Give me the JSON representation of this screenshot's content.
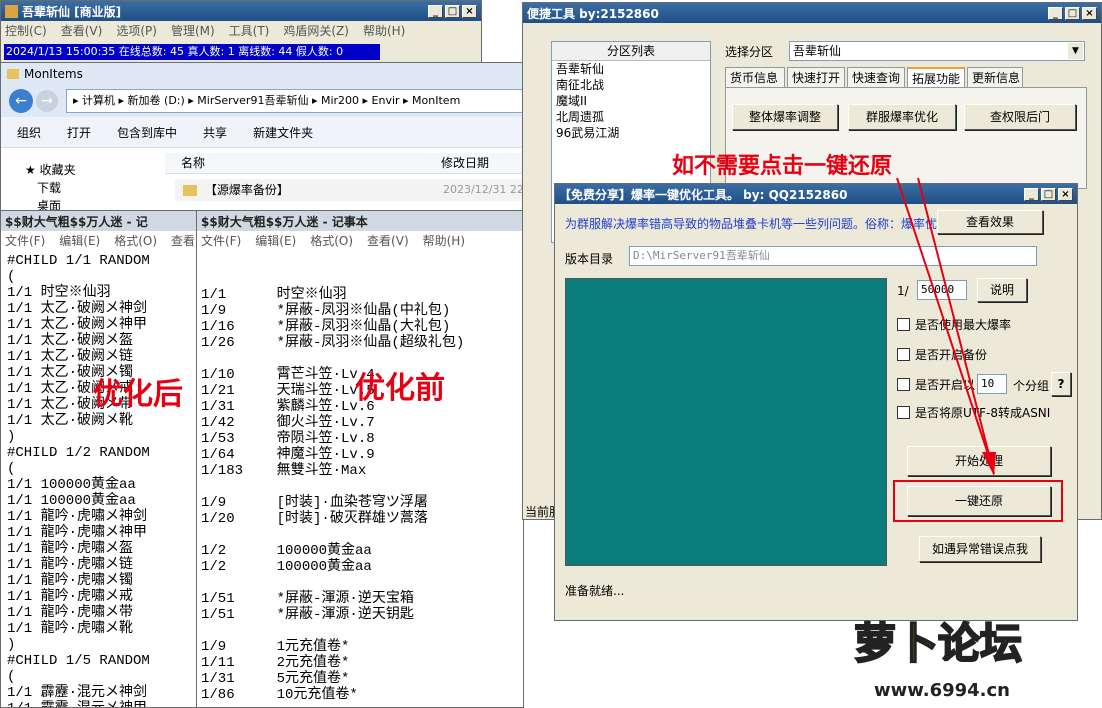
{
  "main_window": {
    "title": "吾辈斩仙 [商业版]",
    "menu": [
      "控制(C)",
      "查看(V)",
      "选项(P)",
      "管理(M)",
      "工具(T)",
      "鸡盾网关(Z)",
      "帮助(H)"
    ],
    "status": "2024/1/13 15:00:35 在线总数: 45 真人数: 1 离线数: 44 假人数: 0"
  },
  "explorer": {
    "title": "MonItems",
    "path": "▸ 计算机 ▸ 新加卷 (D:) ▸ MirServer91吾辈斩仙 ▸ Mir200 ▸ Envir ▸ MonItem",
    "toolbar": [
      "组织",
      "打开",
      "包含到库中",
      "共享",
      "新建文件夹"
    ],
    "nav": [
      "收藏夹",
      "下载",
      "桌面"
    ],
    "columns": [
      "名称",
      "修改日期"
    ],
    "files": [
      {
        "name": "【源爆率备份】",
        "date": "2023/12/31 22"
      }
    ]
  },
  "notepad_left": {
    "title": "$$财大气粗$$万人迷 - 记",
    "menu": [
      "文件(F)",
      "编辑(E)",
      "格式(O)",
      "查看"
    ],
    "lines": [
      "#CHILD 1/1 RANDOM",
      "(",
      "1/1 时空※仙羽",
      "1/1 太乙·破阙メ神剑",
      "1/1 太乙·破阙メ神甲",
      "1/1 太乙·破阙メ盔",
      "1/1 太乙·破阙メ链",
      "1/1 太乙·破阙メ镯",
      "1/1 太乙·破阙メ戒",
      "1/1 太乙·破阙メ带",
      "1/1 太乙·破阙メ靴",
      ")",
      "#CHILD 1/2 RANDOM",
      "(",
      "1/1 100000黄金aa",
      "1/1 100000黄金aa",
      "1/1 龍吟·虎嘯メ神剑",
      "1/1 龍吟·虎嘯メ神甲",
      "1/1 龍吟·虎嘯メ盔",
      "1/1 龍吟·虎嘯メ链",
      "1/1 龍吟·虎嘯メ镯",
      "1/1 龍吟·虎嘯メ戒",
      "1/1 龍吟·虎嘯メ带",
      "1/1 龍吟·虎嘯メ靴",
      ")",
      "#CHILD 1/5 RANDOM",
      "(",
      "1/1 霹靂·混元メ神剑",
      "1/1 霹靂·混元メ神甲"
    ],
    "overlay": "优化后"
  },
  "notepad_right": {
    "title": "$$财大气粗$$万人迷 - 记事本",
    "menu": [
      "文件(F)",
      "编辑(E)",
      "格式(O)",
      "查看(V)",
      "帮助(H)"
    ],
    "lines": [
      "",
      "1/1      时空※仙羽",
      "1/9      *屏蔽-凤羽※仙晶(中礼包)",
      "1/16     *屏蔽-凤羽※仙晶(大礼包)",
      "1/26     *屏蔽-凤羽※仙晶(超级礼包)",
      "",
      "1/10     霄芒斗笠·Lv.4",
      "1/21     天瑞斗笠·Lv.5",
      "1/31     紫麟斗笠·Lv.6",
      "1/42     御火斗笠·Lv.7",
      "1/53     帝陨斗笠·Lv.8",
      "1/64     神魔斗笠·Lv.9",
      "1/183    無雙斗笠·Max",
      "",
      "1/9      [时装]·血染苍穹ツ浮屠",
      "1/20     [时装]·破灭群雄ツ蒿落",
      "",
      "1/2      100000黄金aa",
      "1/2      100000黄金aa",
      "",
      "1/51     *屏蔽-渾源·逆天宝箱",
      "1/51     *屏蔽-渾源·逆天钥匙",
      "",
      "1/9      1元充值卷*",
      "1/11     2元充值卷*",
      "1/31     5元充值卷*",
      "1/86     10元充值卷*"
    ],
    "overlay": "优化前"
  },
  "quick_tool": {
    "title": "便捷工具  by:2152860",
    "partition_header": "分区列表",
    "partitions": [
      "吾辈斩仙",
      "南征北战",
      "魔域II",
      "北周遗孤",
      "96武易江湖"
    ],
    "select_label": "选择分区",
    "select_value": "吾辈斩仙",
    "tabs": [
      "货币信息",
      "快速打开",
      "快速查询",
      "拓展功能",
      "更新信息"
    ],
    "buttons": [
      "整体爆率调整",
      "群服爆率优化",
      "查权限后门"
    ],
    "statusbar": "当前服"
  },
  "annotation": "如不需要点击一键还原",
  "optimizer": {
    "title": "【免费分享】爆率一键优化工具。   by: QQ2152860",
    "desc": "为群服解决爆率错高导致的物品堆叠卡机等一些列问题。俗称：爆率优化",
    "view_effect": "查看效果",
    "version_label": "版本目录",
    "version_path": "D:\\MirServer91吾辈斩仙",
    "ratio_prefix": "1/",
    "ratio_value": "50000",
    "explain": "说明",
    "options": [
      "是否使用最大爆率",
      "是否开启备份",
      "是否开启以",
      "是否将原UTF-8转成ASNI"
    ],
    "group_value": "10",
    "group_suffix": "个分组",
    "help": "?",
    "start": "开始处理",
    "restore": "一键还原",
    "report": "如遇异常错误点我",
    "status": "准备就绪..."
  },
  "watermark": {
    "logo": "萝卜论坛",
    "url": "www.6994.cn"
  }
}
